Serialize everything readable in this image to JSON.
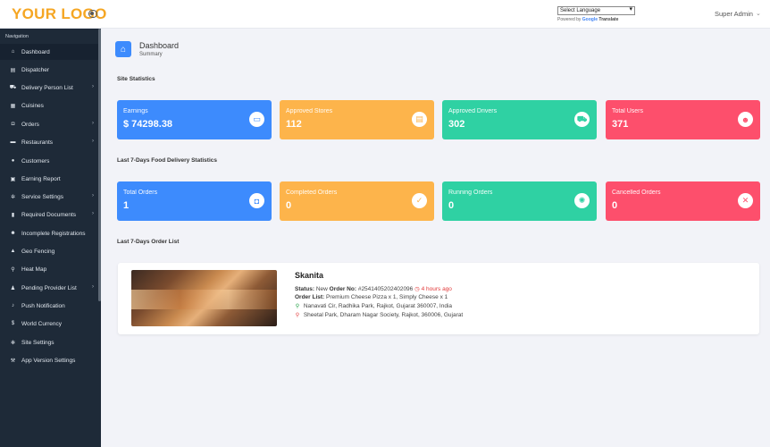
{
  "topbar": {
    "logo": "YOUR LOGO",
    "language_select": "Select Language",
    "powered_prefix": "Powered by",
    "powered_google": "Google",
    "powered_translate": "Translate",
    "admin": "Super Admin"
  },
  "sidebar": {
    "heading": "Navigation",
    "items": [
      {
        "label": "Dashboard",
        "icon": "home-icon",
        "active": true,
        "submenu": false
      },
      {
        "label": "Dispatcher",
        "icon": "dispatch-icon",
        "submenu": false
      },
      {
        "label": "Delivery Person List",
        "icon": "car-icon",
        "submenu": true
      },
      {
        "label": "Cuisines",
        "icon": "cuisine-icon",
        "submenu": false
      },
      {
        "label": "Orders",
        "icon": "orders-icon",
        "submenu": true
      },
      {
        "label": "Restaurants",
        "icon": "restaurant-icon",
        "submenu": true
      },
      {
        "label": "Customers",
        "icon": "customer-icon",
        "submenu": false
      },
      {
        "label": "Earning Report",
        "icon": "report-icon",
        "submenu": false
      },
      {
        "label": "Service Settings",
        "icon": "settings-icon",
        "submenu": true
      },
      {
        "label": "Required Documents",
        "icon": "document-icon",
        "submenu": true
      },
      {
        "label": "Incomplete Registrations",
        "icon": "user-plus-icon",
        "submenu": false
      },
      {
        "label": "Geo Fencing",
        "icon": "map-icon",
        "submenu": false
      },
      {
        "label": "Heat Map",
        "icon": "pin-icon",
        "submenu": false
      },
      {
        "label": "Pending Provider List",
        "icon": "pending-icon",
        "submenu": true
      },
      {
        "label": "Push Notification",
        "icon": "bell-icon",
        "submenu": false
      },
      {
        "label": "World Currency",
        "icon": "dollar-icon",
        "submenu": false
      },
      {
        "label": "Site Settings",
        "icon": "cogs-icon",
        "submenu": false
      },
      {
        "label": "App Version Settings",
        "icon": "wrench-icon",
        "submenu": false
      }
    ]
  },
  "page": {
    "title": "Dashboard",
    "subtitle": "Summary"
  },
  "sections": {
    "site_stats": "Site Statistics",
    "delivery_stats": "Last 7-Days Food Delivery Statistics",
    "order_list": "Last 7-Days Order List"
  },
  "site_stats": [
    {
      "label": "Earnings",
      "value": "$ 74298.38",
      "color": "#3d8bfd",
      "icon": "money-icon"
    },
    {
      "label": "Approved Stores",
      "value": "112",
      "color": "#fdb44b",
      "icon": "store-icon"
    },
    {
      "label": "Approved Drivers",
      "value": "302",
      "color": "#2fd1a3",
      "icon": "truck-icon"
    },
    {
      "label": "Total Users",
      "value": "371",
      "color": "#fd4f6c",
      "icon": "user-add-icon"
    }
  ],
  "delivery_stats": [
    {
      "label": "Total Orders",
      "value": "1",
      "color": "#3d8bfd",
      "icon": "bag-icon"
    },
    {
      "label": "Completed Orders",
      "value": "0",
      "color": "#fdb44b",
      "icon": "check-icon"
    },
    {
      "label": "Running Orders",
      "value": "0",
      "color": "#2fd1a3",
      "icon": "spinner-icon"
    },
    {
      "label": "Cancelled Orders",
      "value": "0",
      "color": "#fd4f6c",
      "icon": "close-icon"
    }
  ],
  "order": {
    "customer": "Skanita",
    "status_label": "Status:",
    "status_value": "New",
    "order_no_label": "Order No:",
    "order_no": "#2541405202402096",
    "time": "4 hours ago",
    "list_label": "Order List:",
    "list_value": "Premium Cheese Pizza x 1, Simply Cheese x 1",
    "pickup": "Nanavati Cir, Radhika Park, Rajkot, Gujarat 360007, India",
    "dropoff": "Sheetal Park, Dharam Nagar Society, Rajkot, 360006, Gujarat"
  }
}
